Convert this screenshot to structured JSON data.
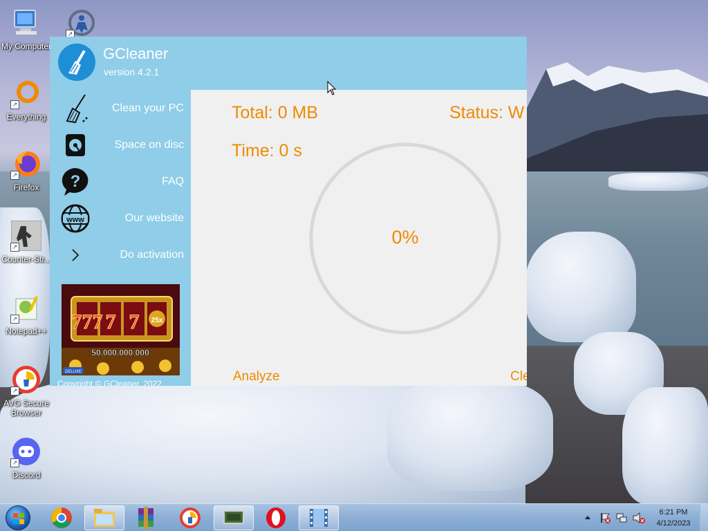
{
  "desktop": {
    "icons": [
      {
        "label": "My Computer",
        "icon": "computer-icon"
      },
      {
        "label": "",
        "icon": "ccleaner-like-icon"
      },
      {
        "label": "Everything",
        "icon": "everything-icon"
      },
      {
        "label": "Firefox",
        "icon": "firefox-icon"
      },
      {
        "label": "Counter-Str...",
        "icon": "counter-strike-icon"
      },
      {
        "label": "Notepad++",
        "icon": "notepadpp-icon"
      },
      {
        "label": "AVG Secure Browser",
        "icon": "avg-browser-icon"
      },
      {
        "label": "Discord",
        "icon": "discord-icon"
      }
    ]
  },
  "gcleaner": {
    "title": "GCleaner",
    "version": "version 4.2.1",
    "nav": [
      {
        "label": "Clean your PC",
        "icon": "broom-icon"
      },
      {
        "label": "Space on disc",
        "icon": "disk-icon"
      },
      {
        "label": "FAQ",
        "icon": "question-icon"
      },
      {
        "label": "Our website",
        "icon": "globe-www-icon"
      },
      {
        "label": "Do activation",
        "icon": "chevron-right-icon"
      }
    ],
    "ad": {
      "jackpot": "50,000,000,000",
      "reels": "777",
      "multiplier": "25x",
      "badge": "DELUXE"
    },
    "copyright": "Copyright © GCleaner, 2022",
    "main": {
      "total": "Total: 0 MB",
      "status": "Status: W",
      "time": "Time: 0 s",
      "progress_label": "0%",
      "progress": 0,
      "analyze_label": "Analyze",
      "clean_label": "Cle"
    },
    "colors": {
      "accent": "#ef8a00",
      "header": "#8fcde8",
      "panel": "#f0f0f0"
    }
  },
  "taskbar": {
    "items": [
      {
        "icon": "chrome-icon",
        "active": false
      },
      {
        "icon": "file-explorer-icon",
        "active": true
      },
      {
        "icon": "winrar-icon",
        "active": false
      },
      {
        "icon": "avg-browser-icon",
        "active": false
      },
      {
        "icon": "remote-desktop-icon",
        "active": false
      },
      {
        "icon": "opera-icon",
        "active": false
      },
      {
        "icon": "video-player-icon",
        "active": true
      }
    ],
    "clock": {
      "time": "6:21 PM",
      "date": "4/12/2023"
    }
  }
}
